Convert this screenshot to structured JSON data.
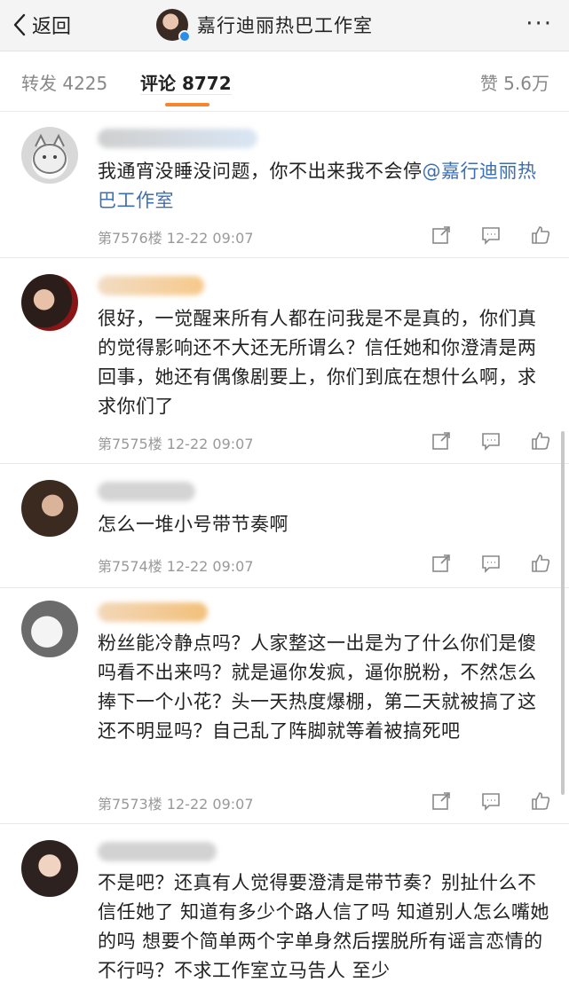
{
  "header": {
    "back_label": "返回",
    "title": "嘉行迪丽热巴工作室",
    "more_label": "···"
  },
  "tabs": {
    "repost_label": "转发 4225",
    "comment_label": "评论 8772",
    "like_label": "赞 5.6万"
  },
  "comments": [
    {
      "text_pre": "我通宵没睡没问题，你不出来我不会停",
      "mention": "@嘉行迪丽热巴工作室",
      "meta": "第7576楼 12-22 09:07"
    },
    {
      "text_pre": "很好，一觉醒来所有人都在问我是不是真的，你们真的觉得影响还不大还无所谓么？信任她和你澄清是两回事，她还有偶像剧要上，你们到底在想什么啊，求求你们了",
      "meta": "第7575楼 12-22 09:07"
    },
    {
      "text_pre": "怎么一堆小号带节奏啊",
      "meta": "第7574楼 12-22 09:07"
    },
    {
      "text_pre": "粉丝能冷静点吗？人家整这一出是为了什么你们是傻吗看不出来吗？就是逼你发疯，逼你脱粉，不然怎么捧下一个小花？头一天热度爆棚，第二天就被搞了这还不明显吗？自己乱了阵脚就等着被搞死吧",
      "meta": "第7573楼 12-22 09:07"
    },
    {
      "text_pre": "不是吧？还真有人觉得要澄清是带节奏？别扯什么不信任她了 知道有多少个路人信了吗 知道别人怎么嘴她的吗 想要个简单两个字单身然后摆脱所有谣言恋情的不行吗？不求工作室立马告人 至少",
      "meta": ""
    }
  ],
  "icons": [
    "back-chevron-icon",
    "verified-badge-icon",
    "more-icon",
    "share-icon",
    "comment-icon",
    "like-icon"
  ],
  "colors": {
    "accent": "#f7852d",
    "mention": "#3d6fb0",
    "meta": "#999999"
  }
}
